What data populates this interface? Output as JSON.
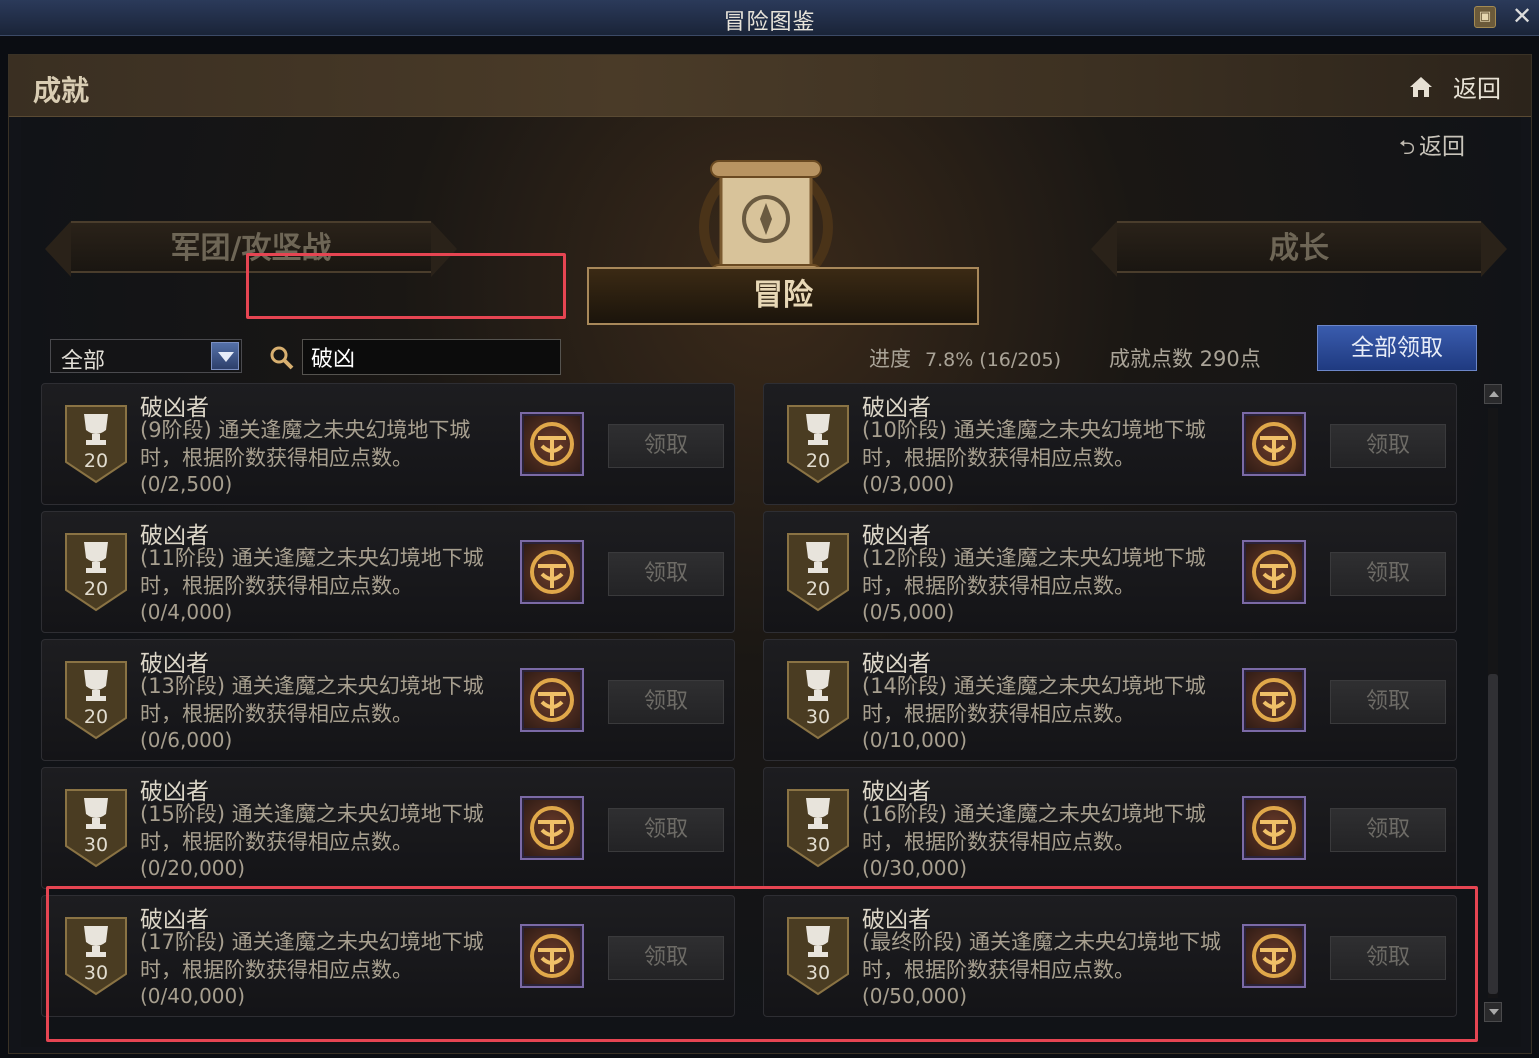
{
  "window": {
    "title": "冒险图鉴"
  },
  "header": {
    "title": "成就",
    "home_back_label": "返回",
    "back_link_label": "返回"
  },
  "tabs": {
    "left": "军团/攻坚战",
    "center": "冒险",
    "right": "成长"
  },
  "filter": {
    "selected": "全部",
    "search_value": "破凶"
  },
  "stats": {
    "progress_label": "进度",
    "progress_value": "7.8% (16/205)",
    "points_text": "成就点数 290点"
  },
  "claim_all_label": "全部领取",
  "claim_label": "领取",
  "achievements": [
    {
      "name": "破凶者",
      "points": "20",
      "desc": "(9阶段) 通关逢魔之未央幻境地下城时，根据阶数获得相应点数。",
      "progress": "(0/2,500)"
    },
    {
      "name": "破凶者",
      "points": "20",
      "desc": "(10阶段) 通关逢魔之未央幻境地下城时，根据阶数获得相应点数。",
      "progress": "(0/3,000)"
    },
    {
      "name": "破凶者",
      "points": "20",
      "desc": "(11阶段) 通关逢魔之未央幻境地下城时，根据阶数获得相应点数。",
      "progress": "(0/4,000)"
    },
    {
      "name": "破凶者",
      "points": "20",
      "desc": "(12阶段) 通关逢魔之未央幻境地下城时，根据阶数获得相应点数。",
      "progress": "(0/5,000)"
    },
    {
      "name": "破凶者",
      "points": "20",
      "desc": "(13阶段) 通关逢魔之未央幻境地下城时，根据阶数获得相应点数。",
      "progress": "(0/6,000)"
    },
    {
      "name": "破凶者",
      "points": "30",
      "desc": "(14阶段) 通关逢魔之未央幻境地下城时，根据阶数获得相应点数。",
      "progress": "(0/10,000)"
    },
    {
      "name": "破凶者",
      "points": "30",
      "desc": "(15阶段) 通关逢魔之未央幻境地下城时，根据阶数获得相应点数。",
      "progress": "(0/20,000)"
    },
    {
      "name": "破凶者",
      "points": "30",
      "desc": "(16阶段) 通关逢魔之未央幻境地下城时，根据阶数获得相应点数。",
      "progress": "(0/30,000)"
    },
    {
      "name": "破凶者",
      "points": "30",
      "desc": "(17阶段) 通关逢魔之未央幻境地下城时，根据阶数获得相应点数。",
      "progress": "(0/40,000)"
    },
    {
      "name": "破凶者",
      "points": "30",
      "desc": "(最终阶段) 通关逢魔之未央幻境地下城时，根据阶数获得相应点数。",
      "progress": "(0/50,000)"
    }
  ],
  "icons": {
    "home": "home-icon",
    "search": "search-icon",
    "trophy": "trophy-icon",
    "reward": "emblem-icon",
    "lock": "lock-icon",
    "close": "close-icon"
  }
}
